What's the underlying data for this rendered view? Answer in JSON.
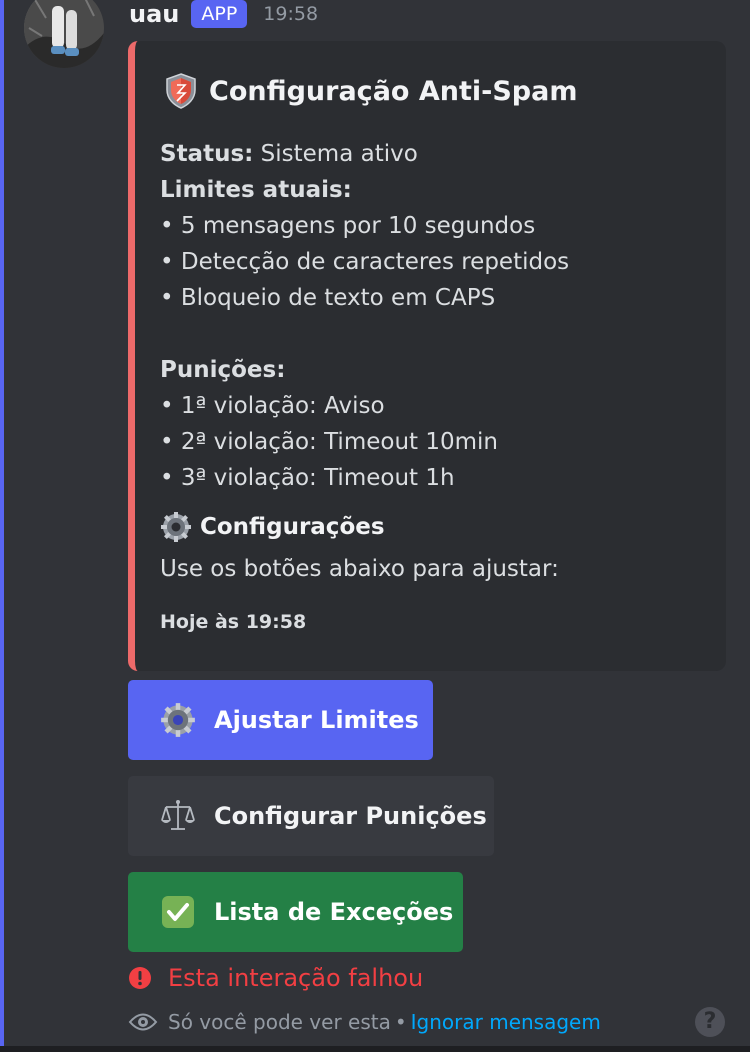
{
  "message": {
    "username": "uau",
    "badge": "APP",
    "timestamp": "19:58",
    "avatar": "user-avatar"
  },
  "embed": {
    "accent_color": "#ed6a6a",
    "title": "Configuração Anti-Spam",
    "title_icon": "shield-icon",
    "status_label": "Status:",
    "status_value": "Sistema ativo",
    "limits_label": "Limites atuais:",
    "limits": [
      "• 5 mensagens por 10 segundos",
      "• Detecção de caracteres repetidos",
      "• Bloqueio de texto em CAPS"
    ],
    "punishments_label": "Punições:",
    "punishments": [
      "• 1ª violação: Aviso",
      "• 2ª violação: Timeout 10min",
      "• 3ª violação: Timeout 1h"
    ],
    "field_icon": "gear-icon",
    "field_name": "Configurações",
    "field_value": "Use os botões abaixo para ajustar:",
    "footer_timestamp": "Hoje às 19:58"
  },
  "buttons": {
    "adjust_limits": {
      "label": "Ajustar Limites",
      "icon": "gear-icon",
      "color": "#5865f2"
    },
    "configure_punishments": {
      "label": "Configurar Punições",
      "icon": "scales-icon",
      "color": "#383a40"
    },
    "exceptions_list": {
      "label": "Lista de Exceções",
      "icon": "check-mark-icon",
      "color": "#248046"
    }
  },
  "error": {
    "icon": "error-icon",
    "text": "Esta interação falhou",
    "color": "#f23f43"
  },
  "ephemeral": {
    "icon": "eye-icon",
    "text": "Só você pode ver esta",
    "separator": "•",
    "dismiss_label": "Ignorar mensagem",
    "help_icon": "help-icon",
    "help_glyph": "?"
  }
}
